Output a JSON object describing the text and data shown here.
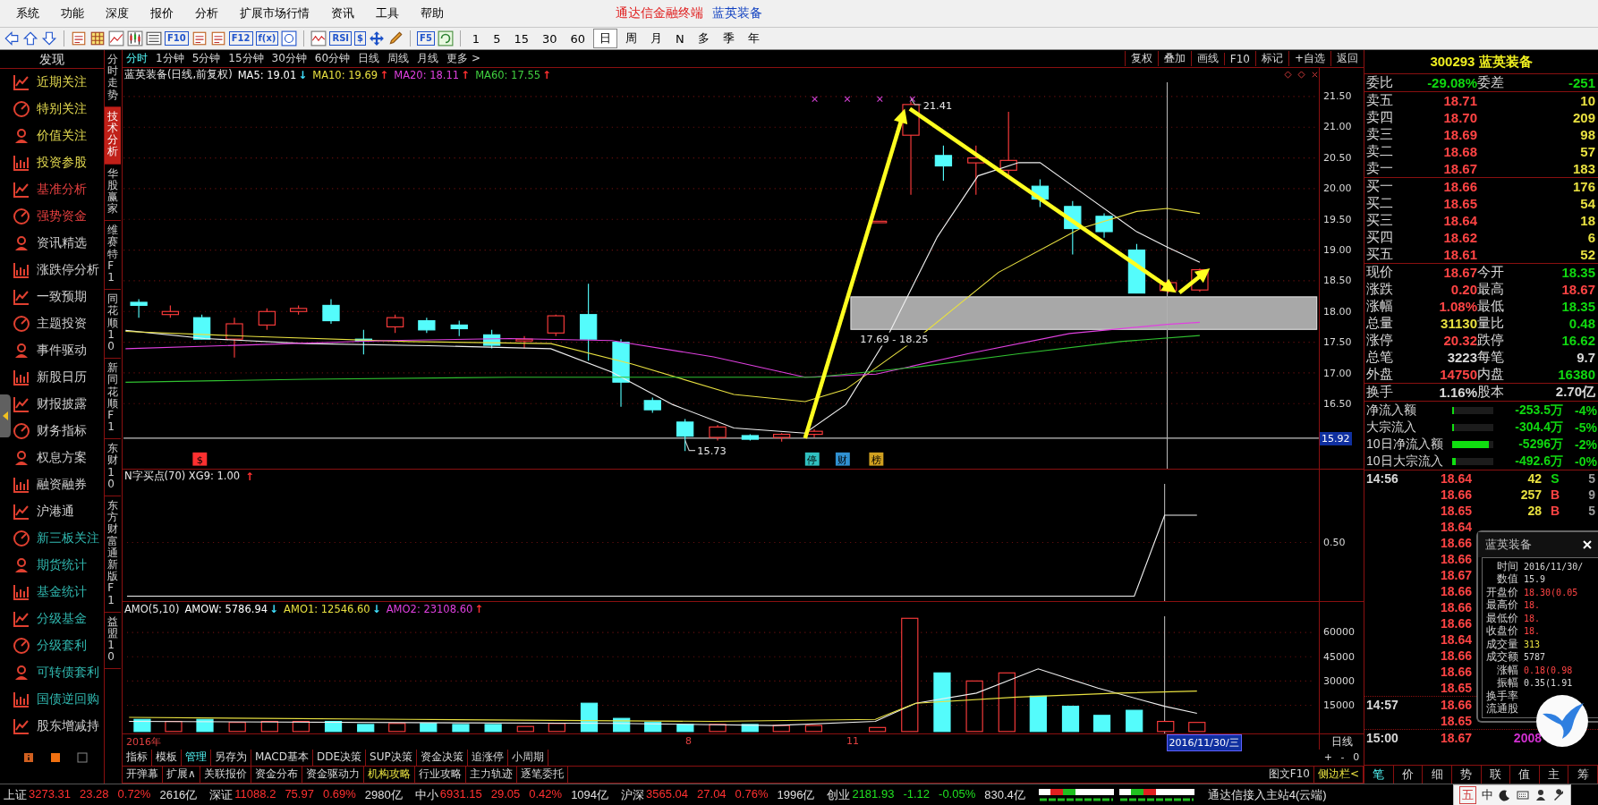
{
  "menu_bar": {
    "items": [
      "系统",
      "功能",
      "深度",
      "报价",
      "分析",
      "扩展市场行情",
      "资讯",
      "工具",
      "帮助"
    ],
    "app_title": "通达信金融终端",
    "stock_title": "蓝英装备"
  },
  "toolbar": {
    "tools": [
      {
        "kind": "back"
      },
      {
        "kind": "up"
      },
      {
        "kind": "down"
      },
      {
        "kind": "doc"
      },
      {
        "kind": "grid"
      },
      {
        "kind": "line"
      },
      {
        "kind": "candle"
      },
      {
        "kind": "list"
      },
      {
        "kind": "label",
        "label": "F10"
      },
      {
        "kind": "doc"
      },
      {
        "kind": "doc"
      },
      {
        "kind": "label",
        "label": "F12"
      },
      {
        "kind": "label",
        "label": "f(x)"
      },
      {
        "kind": "circle"
      },
      {
        "kind": "wave"
      },
      {
        "kind": "label",
        "label": "RSI"
      },
      {
        "kind": "label",
        "label": "$"
      },
      {
        "kind": "move"
      },
      {
        "kind": "pencil"
      },
      {
        "kind": "label",
        "label": "F5"
      },
      {
        "kind": "refresh"
      }
    ],
    "periods": [
      {
        "label": "1",
        "selected": false
      },
      {
        "label": "5",
        "selected": false
      },
      {
        "label": "15",
        "selected": false
      },
      {
        "label": "30",
        "selected": false
      },
      {
        "label": "60",
        "selected": false
      },
      {
        "label": "日",
        "selected": true
      },
      {
        "label": "周",
        "selected": false
      },
      {
        "label": "月",
        "selected": false
      },
      {
        "label": "N",
        "selected": false
      },
      {
        "label": "多",
        "selected": false
      },
      {
        "label": "季",
        "selected": false
      },
      {
        "label": "年",
        "selected": false
      }
    ]
  },
  "sidebar": {
    "title": "发现",
    "items": [
      {
        "label": "近期关注",
        "color": "#e6dc50"
      },
      {
        "label": "特别关注",
        "color": "#e6dc50"
      },
      {
        "label": "价值关注",
        "color": "#e6dc50"
      },
      {
        "label": "投资参股",
        "color": "#e6dc50"
      },
      {
        "label": "基准分析",
        "color": "#e84040"
      },
      {
        "label": "强势资金",
        "color": "#e84040"
      },
      {
        "label": "资讯精选",
        "color": "#d0d0d0"
      },
      {
        "label": "涨跌停分析",
        "color": "#d0d0d0"
      },
      {
        "label": "一致预期",
        "color": "#d0d0d0"
      },
      {
        "label": "主题投资",
        "color": "#d0d0d0"
      },
      {
        "label": "事件驱动",
        "color": "#d0d0d0"
      },
      {
        "label": "新股日历",
        "color": "#d0d0d0"
      },
      {
        "label": "财报披露",
        "color": "#d0d0d0"
      },
      {
        "label": "财务指标",
        "color": "#d0d0d0"
      },
      {
        "label": "权息方案",
        "color": "#d0d0d0"
      },
      {
        "label": "融资融券",
        "color": "#d0d0d0"
      },
      {
        "label": "沪港通",
        "color": "#d0d0d0"
      },
      {
        "label": "新三板关注",
        "color": "#30b8b0"
      },
      {
        "label": "期货统计",
        "color": "#30b8b0"
      },
      {
        "label": "基金统计",
        "color": "#30b8b0"
      },
      {
        "label": "分级基金",
        "color": "#30b8b0"
      },
      {
        "label": "分级套利",
        "color": "#30b8b0"
      },
      {
        "label": "可转债套利",
        "color": "#30b8b0"
      },
      {
        "label": "国债逆回购",
        "color": "#30b8b0"
      },
      {
        "label": "股东增减持",
        "color": "#d0d0d0"
      }
    ]
  },
  "vertical_tabs": [
    {
      "label": "分时走势",
      "selected": false
    },
    {
      "label": "技术分析",
      "selected": true
    },
    {
      "label": "华股赢家",
      "selected": false
    },
    {
      "label": "维赛特F1",
      "selected": false
    },
    {
      "label": "同花顺10",
      "selected": false
    },
    {
      "label": "新同花顺F1",
      "selected": false
    },
    {
      "label": "东财10",
      "selected": false
    },
    {
      "label": "东方财富通新版F1",
      "selected": false
    },
    {
      "label": "益盟10",
      "selected": false
    }
  ],
  "chart_tabs": {
    "periods": [
      {
        "label": "分时",
        "selected": true
      },
      {
        "label": "1分钟",
        "selected": false
      },
      {
        "label": "5分钟",
        "selected": false
      },
      {
        "label": "15分钟",
        "selected": false
      },
      {
        "label": "30分钟",
        "selected": false
      },
      {
        "label": "60分钟",
        "selected": false
      },
      {
        "label": "日线",
        "selected": false
      },
      {
        "label": "周线",
        "selected": false
      },
      {
        "label": "月线",
        "selected": false
      },
      {
        "label": "更多 >",
        "selected": false
      }
    ],
    "buttons": [
      "复权",
      "叠加",
      "画线",
      "F10",
      "标记",
      "+自选",
      "返回"
    ]
  },
  "main_chart": {
    "title": "蓝英装备(日线,前复权)",
    "averages": [
      {
        "label": "MA5: 19.01",
        "arrow": "↓",
        "rising": false,
        "color": "#ffffff"
      },
      {
        "label": "MA10: 19.69",
        "arrow": "↑",
        "rising": true,
        "color": "#e8e040"
      },
      {
        "label": "MA20: 18.11",
        "arrow": "↑",
        "rising": true,
        "color": "#e040e0"
      },
      {
        "label": "MA60: 17.55",
        "arrow": "↑",
        "rising": true,
        "color": "#40d040"
      }
    ],
    "price_axis": [
      "21.50",
      "21.00",
      "20.50",
      "20.00",
      "19.50",
      "19.00",
      "18.50",
      "18.00",
      "17.50",
      "17.00",
      "16.50"
    ],
    "crosshair_value": "15.92",
    "high_label": "21.41",
    "low_label": "15.73",
    "zone_label": "17.69 - 18.25",
    "event_markers": [
      {
        "label": "$",
        "color": "#ff3030"
      },
      {
        "label": "停",
        "color": "#30c0c0"
      },
      {
        "label": "财",
        "color": "#3090d0"
      },
      {
        "label": "榜",
        "color": "#d0a020"
      }
    ]
  },
  "signal_panel": {
    "title": "N字买点(70) XG9: 1.00",
    "arrow": "↑",
    "rising": true,
    "axis": [
      "0.50"
    ]
  },
  "volume_panel": {
    "title": "AMO(5,10)",
    "averages": [
      {
        "label": "AMOW: 5786.94",
        "arrow": "↓",
        "rising": false,
        "color": "#ffffff"
      },
      {
        "label": "AMO1: 12546.60",
        "arrow": "↓",
        "rising": false,
        "color": "#e8e040"
      },
      {
        "label": "AMO2: 23108.60",
        "arrow": "↑",
        "rising": true,
        "color": "#e040e0"
      }
    ],
    "axis": [
      "60000",
      "45000",
      "30000",
      "15000"
    ]
  },
  "date_axis": {
    "labels": [
      "2016年",
      "8",
      "11"
    ],
    "cursor_date": "2016/11/30/三",
    "period_label": "日线",
    "zoom_buttons": [
      "+",
      "-",
      "0"
    ]
  },
  "bottom_tabs": {
    "row_1": [
      {
        "label": "指标",
        "selected": false
      },
      {
        "label": "模板",
        "selected": false
      },
      {
        "label": "管理",
        "selected": true
      },
      {
        "label": "另存为",
        "selected": false
      },
      {
        "label": "MACD基本",
        "selected": false
      },
      {
        "label": "DDE决策",
        "selected": false
      },
      {
        "label": "SUP决策",
        "selected": false
      },
      {
        "label": "资金决策",
        "selected": false
      },
      {
        "label": "追涨停",
        "selected": false
      },
      {
        "label": "小周期",
        "selected": false
      }
    ],
    "row_2": [
      {
        "label": "开弹幕",
        "selected": false
      },
      {
        "label": "扩展∧",
        "selected": false
      },
      {
        "label": "关联报价",
        "selected": false
      },
      {
        "label": "资金分布",
        "selected": false
      },
      {
        "label": "资金驱动力",
        "selected": false
      },
      {
        "label": "机构攻略",
        "selected": true
      },
      {
        "label": "行业攻略",
        "selected": false
      },
      {
        "label": "主力轨迹",
        "selected": false
      },
      {
        "label": "逐笔委托",
        "selected": false
      }
    ],
    "right_buttons": [
      {
        "label": "图文F10",
        "selected": false
      },
      {
        "label": "侧边栏<",
        "selected": true
      }
    ]
  },
  "quote_panel": {
    "title": "300293 蓝英装备",
    "ratio": [
      {
        "label": "委比",
        "value": "-29.08%"
      },
      {
        "label": "委差",
        "value": "-251"
      }
    ],
    "asks": [
      {
        "label": "卖五",
        "price": "18.71",
        "volume": "10"
      },
      {
        "label": "卖四",
        "price": "18.70",
        "volume": "209"
      },
      {
        "label": "卖三",
        "price": "18.69",
        "volume": "98"
      },
      {
        "label": "卖二",
        "price": "18.68",
        "volume": "57"
      },
      {
        "label": "卖一",
        "price": "18.67",
        "volume": "183"
      }
    ],
    "bids": [
      {
        "label": "买一",
        "price": "18.66",
        "volume": "176"
      },
      {
        "label": "买二",
        "price": "18.65",
        "volume": "54"
      },
      {
        "label": "买三",
        "price": "18.64",
        "volume": "18"
      },
      {
        "label": "买四",
        "price": "18.62",
        "volume": "6"
      },
      {
        "label": "买五",
        "price": "18.61",
        "volume": "52"
      }
    ],
    "stats": [
      {
        "label": "现价",
        "value": "18.67",
        "color": "#ff4444"
      },
      {
        "label": "今开",
        "value": "18.35",
        "color": "#10d810"
      },
      {
        "label": "涨跌",
        "value": "0.20",
        "color": "#ff4444"
      },
      {
        "label": "最高",
        "value": "18.67",
        "color": "#ff4444"
      },
      {
        "label": "涨幅",
        "value": "1.08%",
        "color": "#ff4444"
      },
      {
        "label": "最低",
        "value": "18.35",
        "color": "#10d810"
      },
      {
        "label": "总量",
        "value": "31130",
        "color": "#e8e040"
      },
      {
        "label": "量比",
        "value": "0.48",
        "color": "#10d810"
      },
      {
        "label": "涨停",
        "value": "20.32",
        "color": "#ff4444"
      },
      {
        "label": "跌停",
        "value": "16.62",
        "color": "#10d810"
      },
      {
        "label": "总笔",
        "value": "3223",
        "color": "#d8d8d8"
      },
      {
        "label": "每笔",
        "value": "9.7",
        "color": "#d8d8d8"
      },
      {
        "label": "外盘",
        "value": "14750",
        "color": "#ff4444"
      },
      {
        "label": "内盘",
        "value": "16380",
        "color": "#10d810"
      }
    ],
    "turnover": [
      {
        "label": "换手",
        "value": "1.16%"
      },
      {
        "label": "股本",
        "value": "2.70亿"
      }
    ],
    "flows": [
      {
        "label": "净流入额",
        "level": 0.04,
        "amount": "-253.5万",
        "pct": "-4%"
      },
      {
        "label": "大宗流入",
        "level": 0.04,
        "amount": "-304.4万",
        "pct": "-5%"
      },
      {
        "label": "10日净流入额",
        "level": 0.9,
        "amount": "-5296万",
        "pct": "-2%"
      },
      {
        "label": "10日大宗流入",
        "level": 0.08,
        "amount": "-492.6万",
        "pct": "-0%"
      }
    ],
    "ticks": [
      {
        "time": "14:56",
        "price": "18.64",
        "volume": {
          "text": "42",
          "color": "#e8e040"
        },
        "side": {
          "text": "S",
          "color": "#10d810"
        },
        "count": "5"
      },
      {
        "price": "18.66",
        "volume": {
          "text": "257",
          "color": "#e8e040"
        },
        "side": {
          "text": "B",
          "color": "#ff4444"
        },
        "count": "9"
      },
      {
        "price": "18.65",
        "volume": {
          "text": "28",
          "color": "#e8e040"
        },
        "side": {
          "text": "B",
          "color": "#ff4444"
        },
        "count": "5"
      },
      {
        "price": "18.64"
      },
      {
        "price": "18.66"
      },
      {
        "price": "18.66"
      },
      {
        "price": "18.67"
      },
      {
        "price": "18.66"
      },
      {
        "price": "18.66"
      },
      {
        "price": "18.66"
      },
      {
        "price": "18.64"
      },
      {
        "price": "18.66"
      },
      {
        "price": "18.66"
      },
      {
        "price": "18.65"
      },
      {
        "time": "14:57",
        "price": "18.66"
      },
      {
        "price": "18.65"
      },
      {
        "time": "15:00",
        "price": "18.67",
        "volume": {
          "text": "2008",
          "color": "#d030d0"
        }
      }
    ],
    "tabs": [
      {
        "label": "笔",
        "selected": true
      },
      {
        "label": "价",
        "selected": false
      },
      {
        "label": "细",
        "selected": false
      },
      {
        "label": "势",
        "selected": false
      },
      {
        "label": "联",
        "selected": false
      },
      {
        "label": "值",
        "selected": false
      },
      {
        "label": "主",
        "selected": false
      },
      {
        "label": "筹",
        "selected": false
      }
    ]
  },
  "popup": {
    "title": "蓝英装备",
    "rows": [
      {
        "label": "时间",
        "value": "2016/11/30/",
        "color": "#d8d8d8"
      },
      {
        "label": "数值",
        "value": "15.9",
        "color": "#d8d8d8"
      },
      {
        "label": "开盘价",
        "value": "18.30(0.05",
        "color": "#ff4444"
      },
      {
        "label": "最高价",
        "value": "18.",
        "color": "#ff4444"
      },
      {
        "label": "最低价",
        "value": "18.",
        "color": "#ff4444"
      },
      {
        "label": "收盘价",
        "value": "18.",
        "color": "#ff4444"
      },
      {
        "label": "成交量",
        "value": "313",
        "color": "#e8e040"
      },
      {
        "label": "成交额",
        "value": "5787",
        "color": "#d8d8d8"
      },
      {
        "label": "涨幅",
        "value": "0.18(0.98",
        "color": "#ff4444"
      },
      {
        "label": "振幅",
        "value": "0.35(1.91",
        "color": "#d8d8d8"
      },
      {
        "label": "换手率"
      },
      {
        "label": "流通股"
      }
    ]
  },
  "status_bar": {
    "indices": [
      {
        "name": "上证",
        "value": "3273.31",
        "change": "23.28",
        "pct": "0.72%",
        "amount": "2616亿",
        "color": "#ff3030"
      },
      {
        "name": "深证",
        "value": "11088.2",
        "change": "75.97",
        "pct": "0.69%",
        "amount": "2980亿",
        "color": "#ff3030"
      },
      {
        "name": "中小",
        "value": "6931.15",
        "change": "29.05",
        "pct": "0.42%",
        "amount": "1094亿",
        "color": "#ff3030"
      },
      {
        "name": "沪深",
        "value": "3565.04",
        "change": "27.04",
        "pct": "0.76%",
        "amount": "1996亿",
        "color": "#ff3030"
      },
      {
        "name": "创业",
        "value": "2181.93",
        "change": "-1.12",
        "pct": "-0.05%",
        "amount": "830.4亿",
        "color": "#20e020"
      }
    ],
    "connection": "通达信接入主站4(云端)"
  },
  "ime_bar": {
    "labels": [
      "五",
      "中"
    ]
  }
}
